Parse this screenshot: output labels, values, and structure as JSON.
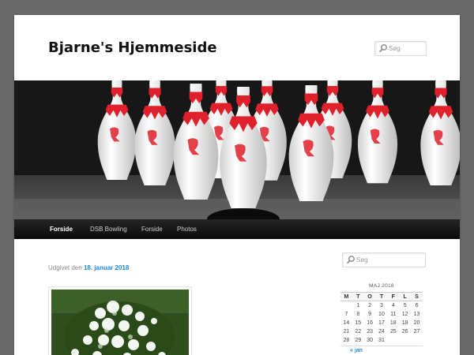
{
  "site": {
    "title": "Bjarne's Hjemmeside"
  },
  "header_search": {
    "placeholder": "Søg"
  },
  "nav": {
    "items": [
      {
        "label": "Forside",
        "active": true
      },
      {
        "label": "DSB Bowling",
        "active": false
      },
      {
        "label": "Forside",
        "active": false
      },
      {
        "label": "Photos",
        "active": false
      }
    ]
  },
  "post": {
    "posted_prefix": "Udgivet den",
    "date": "18. januar 2018"
  },
  "sidebar": {
    "search_placeholder": "Søg",
    "calendar": {
      "caption": "MAJ 2018",
      "weekdays": [
        "M",
        "T",
        "O",
        "T",
        "F",
        "L",
        "S"
      ],
      "weeks": [
        [
          "",
          "1",
          "2",
          "3",
          "4",
          "5",
          "6"
        ],
        [
          "7",
          "8",
          "9",
          "10",
          "11",
          "12",
          "13"
        ],
        [
          "14",
          "15",
          "16",
          "17",
          "18",
          "19",
          "20"
        ],
        [
          "21",
          "22",
          "23",
          "24",
          "25",
          "26",
          "27"
        ],
        [
          "28",
          "29",
          "30",
          "31",
          "",
          "",
          ""
        ]
      ],
      "prev_label": "« jan"
    }
  },
  "colors": {
    "link": "#1b8be0",
    "nav_bg": "#151515",
    "pin_stripe": "#e0202a"
  }
}
